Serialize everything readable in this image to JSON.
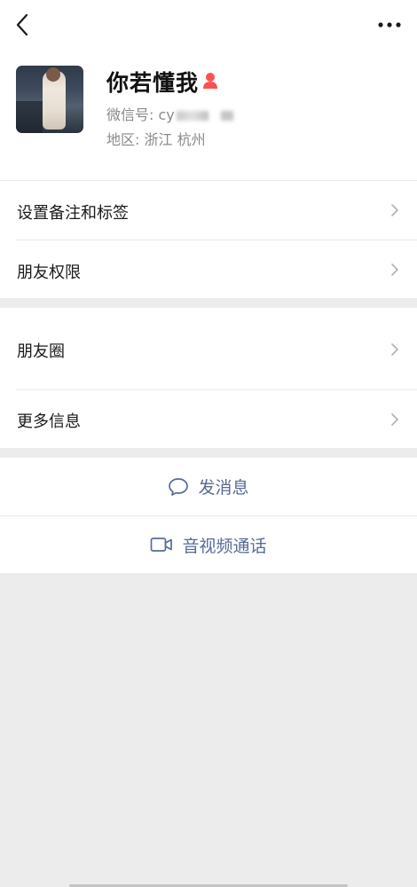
{
  "nav": {
    "back_icon": "chevron-left-icon",
    "more_icon": "ellipsis-icon"
  },
  "profile": {
    "nickname": "你若懂我",
    "gender_icon": "female-icon",
    "gender_color": "#fa5151",
    "wechat_id_label": "微信号: cy",
    "region_label": "地区: 浙江  杭州"
  },
  "menu_group_1": [
    {
      "label": "设置备注和标签"
    },
    {
      "label": "朋友权限"
    }
  ],
  "menu_group_2": [
    {
      "label": "朋友圈"
    },
    {
      "label": "更多信息"
    }
  ],
  "actions": {
    "message": "发消息",
    "av_call": "音视频通话",
    "link_color": "#576b95"
  }
}
